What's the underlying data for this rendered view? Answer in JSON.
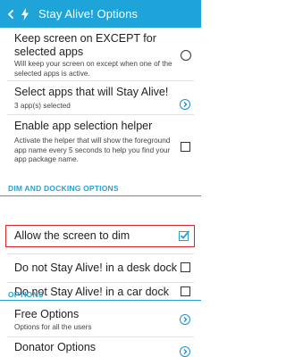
{
  "appbar": {
    "title": "Stay Alive! Options"
  },
  "items": [
    {
      "title_line1": "Keep screen on EXCEPT for",
      "title_line2": "selected apps",
      "subtitle": "Will keep your screen on except when one of the selected apps is active."
    },
    {
      "title": "Select apps that will Stay Alive!",
      "subtitle": "3 app(s) selected"
    },
    {
      "title": "Enable app selection helper",
      "subtitle": "Activate the helper that will show the foreground app name every 5 seconds to help you find your app package name."
    }
  ],
  "section1": "DIM AND DOCKING OPTIONS",
  "dock_items": [
    {
      "title": "Allow the screen to dim",
      "checked": true
    },
    {
      "title": "Do not Stay Alive! in a desk dock",
      "checked": false
    },
    {
      "title": "Do not Stay Alive! in a car dock",
      "checked": false
    }
  ],
  "section2": "OPTIONS",
  "options": [
    {
      "title": "Free Options",
      "subtitle": "Options for all the users"
    },
    {
      "title": "Donator Options"
    }
  ],
  "colors": {
    "appbar": "#1fa4da",
    "accent": "#2aa0d2",
    "highlight": "#d9262a"
  }
}
